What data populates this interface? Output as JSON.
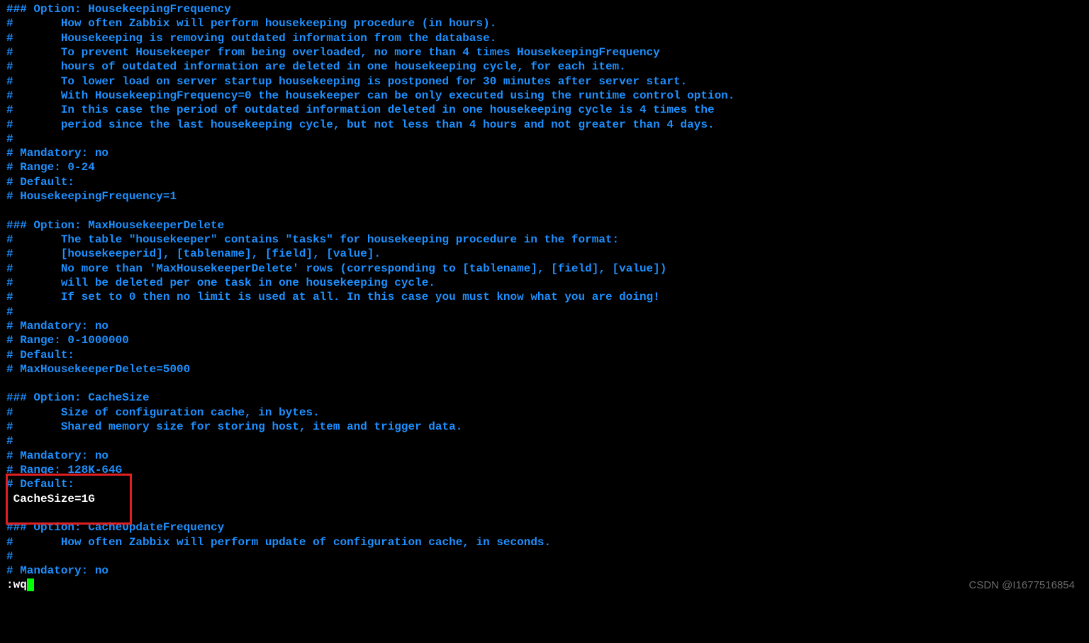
{
  "lines": [
    {
      "text": "### Option: HousekeepingFrequency",
      "type": "comment"
    },
    {
      "text": "#       How often Zabbix will perform housekeeping procedure (in hours).",
      "type": "comment"
    },
    {
      "text": "#       Housekeeping is removing outdated information from the database.",
      "type": "comment"
    },
    {
      "text": "#       To prevent Housekeeper from being overloaded, no more than 4 times HousekeepingFrequency",
      "type": "comment"
    },
    {
      "text": "#       hours of outdated information are deleted in one housekeeping cycle, for each item.",
      "type": "comment"
    },
    {
      "text": "#       To lower load on server startup housekeeping is postponed for 30 minutes after server start.",
      "type": "comment"
    },
    {
      "text": "#       With HousekeepingFrequency=0 the housekeeper can be only executed using the runtime control option.",
      "type": "comment"
    },
    {
      "text": "#       In this case the period of outdated information deleted in one housekeeping cycle is 4 times the",
      "type": "comment"
    },
    {
      "text": "#       period since the last housekeeping cycle, but not less than 4 hours and not greater than 4 days.",
      "type": "comment"
    },
    {
      "text": "#",
      "type": "comment"
    },
    {
      "text": "# Mandatory: no",
      "type": "comment"
    },
    {
      "text": "# Range: 0-24",
      "type": "comment"
    },
    {
      "text": "# Default:",
      "type": "comment"
    },
    {
      "text": "# HousekeepingFrequency=1",
      "type": "comment"
    },
    {
      "text": "",
      "type": "blank"
    },
    {
      "text": "### Option: MaxHousekeeperDelete",
      "type": "comment"
    },
    {
      "text": "#       The table \"housekeeper\" contains \"tasks\" for housekeeping procedure in the format:",
      "type": "comment"
    },
    {
      "text": "#       [housekeeperid], [tablename], [field], [value].",
      "type": "comment"
    },
    {
      "text": "#       No more than 'MaxHousekeeperDelete' rows (corresponding to [tablename], [field], [value])",
      "type": "comment"
    },
    {
      "text": "#       will be deleted per one task in one housekeeping cycle.",
      "type": "comment"
    },
    {
      "text": "#       If set to 0 then no limit is used at all. In this case you must know what you are doing!",
      "type": "comment"
    },
    {
      "text": "#",
      "type": "comment"
    },
    {
      "text": "# Mandatory: no",
      "type": "comment"
    },
    {
      "text": "# Range: 0-1000000",
      "type": "comment"
    },
    {
      "text": "# Default:",
      "type": "comment"
    },
    {
      "text": "# MaxHousekeeperDelete=5000",
      "type": "comment"
    },
    {
      "text": "",
      "type": "blank"
    },
    {
      "text": "### Option: CacheSize",
      "type": "comment"
    },
    {
      "text": "#       Size of configuration cache, in bytes.",
      "type": "comment"
    },
    {
      "text": "#       Shared memory size for storing host, item and trigger data.",
      "type": "comment"
    },
    {
      "text": "#",
      "type": "comment"
    },
    {
      "text": "# Mandatory: no",
      "type": "comment"
    },
    {
      "text": "# Range: 128K-64G",
      "type": "comment"
    },
    {
      "text": "# Default:",
      "type": "comment"
    },
    {
      "text": " CacheSize=1G",
      "type": "plain"
    },
    {
      "text": "",
      "type": "blank"
    },
    {
      "text": "### Option: CacheUpdateFrequency",
      "type": "comment"
    },
    {
      "text": "#       How often Zabbix will perform update of configuration cache, in seconds.",
      "type": "comment"
    },
    {
      "text": "#",
      "type": "comment"
    },
    {
      "text": "# Mandatory: no",
      "type": "comment"
    }
  ],
  "command": ":wq",
  "watermark": "CSDN @I1677516854"
}
